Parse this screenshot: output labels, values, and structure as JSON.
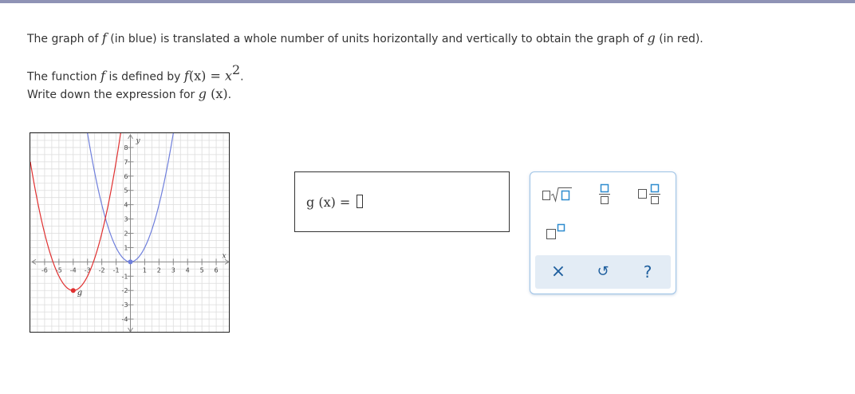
{
  "question": {
    "line1_a": "The graph of ",
    "line1_f": "f",
    "line1_b": " (in blue) is translated a whole number of units horizontally and vertically to obtain the graph of ",
    "line1_g": "g",
    "line1_c": " (in red).",
    "line2_a": "The function ",
    "line2_f": "f",
    "line2_b": " is defined by ",
    "line2_fx": "f",
    "line2_paren": "(x)",
    "line2_eq": " = ",
    "line2_x": "x",
    "line2_exp": "2",
    "line2_end": ".",
    "line3_a": "Write down the expression for ",
    "line3_g": "g",
    "line3_paren": " (x)",
    "line3_end": "."
  },
  "graph": {
    "x_axis_label": "x",
    "y_axis_label": "y",
    "x_tick_labels": [
      "-6",
      "-5",
      "-4",
      "-3",
      "-2",
      "-1",
      "1",
      "2",
      "3",
      "4",
      "5",
      "6"
    ],
    "y_tick_labels": [
      "8",
      "7",
      "6",
      "5",
      "4",
      "3",
      "2",
      "1",
      "-1",
      "-2",
      "-3",
      "-4"
    ],
    "x_range": [
      -7,
      7
    ],
    "y_range": [
      -5,
      9
    ],
    "g_label": "g",
    "colors": {
      "f": "#6f7fdc",
      "g": "#e03030",
      "grid": "#dddddd",
      "axis": "#888888"
    },
    "f_vertex": [
      0,
      0
    ],
    "g_vertex": [
      -4,
      -2
    ]
  },
  "answer": {
    "label": "g (x) = ",
    "value": ""
  },
  "palette": {
    "buttons": [
      "sqrt-template",
      "fraction-template",
      "mixed-number-template",
      "superscript-template"
    ],
    "actions": {
      "clear": "×",
      "undo": "↺",
      "help": "?"
    },
    "accent": "#2e8ccf"
  }
}
